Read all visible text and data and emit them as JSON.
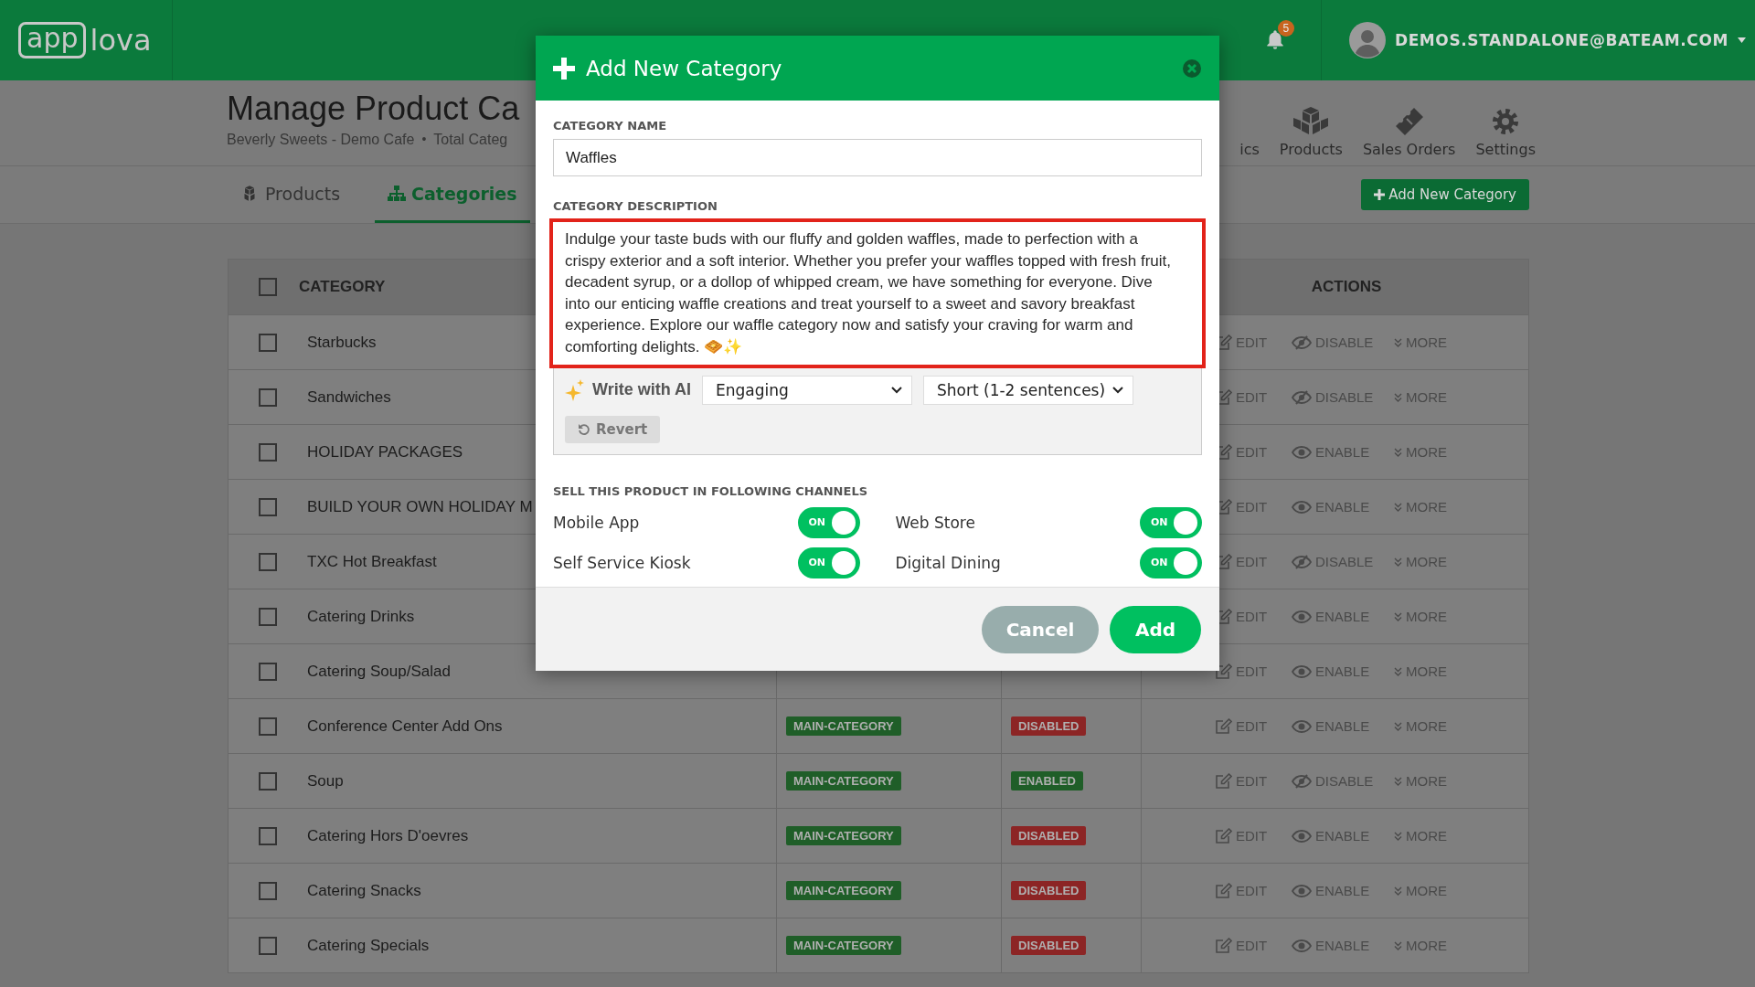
{
  "top_bar": {
    "logo_boxed": "app",
    "logo_text": "lova",
    "notification_count": "5",
    "user_email": "DEMOS.STANDALONE@BATEAM.COM"
  },
  "header": {
    "title": "Manage Product Ca",
    "store": "Beverly Sweets - Demo Cafe",
    "separator": "•",
    "count": "Total Categ",
    "nav": [
      {
        "label": "ics",
        "kind": "analytics"
      },
      {
        "label": "Products",
        "kind": "products"
      },
      {
        "label": "Sales Orders",
        "kind": "orders"
      },
      {
        "label": "Settings",
        "kind": "settings"
      }
    ]
  },
  "tabs": [
    {
      "label": "Products",
      "kind": "cubes",
      "selected": false
    },
    {
      "label": "Categories",
      "kind": "sitemap",
      "selected": true
    }
  ],
  "add_button": "Add New Category",
  "table": {
    "columns": {
      "category": "CATEGORY",
      "actions": "ACTIONS"
    },
    "all_checked": false,
    "rows": [
      {
        "name": "Starbucks",
        "checked": false,
        "edit": "EDIT",
        "toggle": {
          "label": "DISABLE",
          "kind": "disable"
        },
        "more": "MORE"
      },
      {
        "name": "Sandwiches",
        "checked": false,
        "edit": "EDIT",
        "toggle": {
          "label": "DISABLE",
          "kind": "disable"
        },
        "more": "MORE"
      },
      {
        "name": "HOLIDAY PACKAGES",
        "checked": false,
        "edit": "EDIT",
        "toggle": {
          "label": "ENABLE",
          "kind": "enable"
        },
        "more": "MORE"
      },
      {
        "name": "BUILD YOUR OWN HOLIDAY M",
        "checked": false,
        "edit": "EDIT",
        "toggle": {
          "label": "ENABLE",
          "kind": "enable"
        },
        "more": "MORE"
      },
      {
        "name": "TXC Hot Breakfast",
        "checked": false,
        "edit": "EDIT",
        "toggle": {
          "label": "DISABLE",
          "kind": "disable"
        },
        "more": "MORE"
      },
      {
        "name": "Catering Drinks",
        "checked": false,
        "edit": "EDIT",
        "toggle": {
          "label": "ENABLE",
          "kind": "enable"
        },
        "more": "MORE"
      },
      {
        "name": "Catering Soup/Salad",
        "checked": false,
        "edit": "EDIT",
        "toggle": {
          "label": "ENABLE",
          "kind": "enable"
        },
        "more": "MORE"
      },
      {
        "name": "Conference Center Add Ons",
        "checked": false,
        "type": "MAIN-CATEGORY",
        "status": {
          "label": "DISABLED",
          "kind": "disabled"
        },
        "edit": "EDIT",
        "toggle": {
          "label": "ENABLE",
          "kind": "enable"
        },
        "more": "MORE"
      },
      {
        "name": "Soup",
        "checked": false,
        "type": "MAIN-CATEGORY",
        "status": {
          "label": "ENABLED",
          "kind": "enabled"
        },
        "edit": "EDIT",
        "toggle": {
          "label": "DISABLE",
          "kind": "disable"
        },
        "more": "MORE"
      },
      {
        "name": "Catering Hors D'oevres",
        "checked": false,
        "type": "MAIN-CATEGORY",
        "status": {
          "label": "DISABLED",
          "kind": "disabled"
        },
        "edit": "EDIT",
        "toggle": {
          "label": "ENABLE",
          "kind": "enable"
        },
        "more": "MORE"
      },
      {
        "name": "Catering Snacks",
        "checked": false,
        "type": "MAIN-CATEGORY",
        "status": {
          "label": "DISABLED",
          "kind": "disabled"
        },
        "edit": "EDIT",
        "toggle": {
          "label": "ENABLE",
          "kind": "enable"
        },
        "more": "MORE"
      },
      {
        "name": "Catering Specials",
        "checked": false,
        "type": "MAIN-CATEGORY",
        "status": {
          "label": "DISABLED",
          "kind": "disabled"
        },
        "edit": "EDIT",
        "toggle": {
          "label": "ENABLE",
          "kind": "enable"
        },
        "more": "MORE"
      }
    ]
  },
  "modal": {
    "title": "Add New Category",
    "name_label": "CATEGORY NAME",
    "name_value": "Waffles",
    "description_label": "CATEGORY DESCRIPTION",
    "description_value": "Indulge your taste buds with our fluffy and golden waffles, made to perfection with a crispy exterior and a soft interior. Whether you prefer your waffles topped with fresh fruit, decadent syrup, or a dollop of whipped cream, we have something for everyone. Dive into our enticing waffle creations and treat yourself to a sweet and savory breakfast experience. Explore our waffle category now and satisfy your craving for warm and comforting delights. 🧇✨",
    "description_highlighted": true,
    "ai": {
      "label": "Write with AI",
      "tone": "Engaging",
      "length": "Short (1-2 sentences)",
      "revert": "Revert"
    },
    "channels_label": "SELL THIS PRODUCT IN FOLLOWING CHANNELS",
    "channels": [
      {
        "name": "Mobile App",
        "on": true,
        "toggle_text": "ON"
      },
      {
        "name": "Web Store",
        "on": true,
        "toggle_text": "ON"
      },
      {
        "name": "Self Service Kiosk",
        "on": true,
        "toggle_text": "ON"
      },
      {
        "name": "Digital Dining",
        "on": true,
        "toggle_text": "ON"
      }
    ],
    "cancel": "Cancel",
    "add": "Add"
  }
}
